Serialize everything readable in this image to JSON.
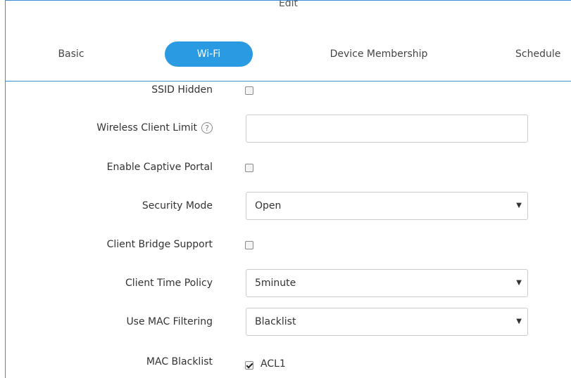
{
  "dialog": {
    "title": "Edit"
  },
  "tabs": [
    {
      "label": "Basic",
      "active": false
    },
    {
      "label": "Wi-Fi",
      "active": true
    },
    {
      "label": "Device Membership",
      "active": false
    },
    {
      "label": "Schedule",
      "active": false
    }
  ],
  "form": {
    "ssid_hidden": {
      "label": "SSID Hidden",
      "checked": false
    },
    "wireless_client_limit": {
      "label": "Wireless Client Limit",
      "help_icon": "?",
      "value": ""
    },
    "enable_captive_portal": {
      "label": "Enable Captive Portal",
      "checked": false
    },
    "security_mode": {
      "label": "Security Mode",
      "value": "Open"
    },
    "client_bridge_support": {
      "label": "Client Bridge Support",
      "checked": false
    },
    "client_time_policy": {
      "label": "Client Time Policy",
      "value": "5minute"
    },
    "use_mac_filtering": {
      "label": "Use MAC Filtering",
      "value": "Blacklist"
    },
    "mac_blacklist": {
      "label": "MAC Blacklist",
      "option_label": "ACL1",
      "checked": true
    }
  },
  "colors": {
    "accent": "#2a9ae3",
    "border": "#3a8fd6"
  },
  "icons": {
    "select_caret": "▼"
  }
}
